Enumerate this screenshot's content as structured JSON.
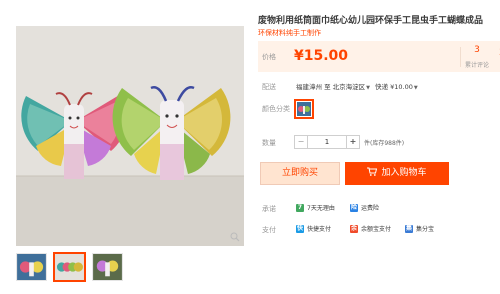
{
  "product": {
    "title": "废物利用纸筒面巾纸心幼儿园环保手工昆虫手工蝴蝶成品",
    "subtitle": "环保材料纯手工制作"
  },
  "price": {
    "label": "价格",
    "value": "¥15.00",
    "review_count": "3",
    "review_label": "累计评论",
    "peek_text": "3"
  },
  "shipping": {
    "label": "配送",
    "from": "福建漳州",
    "to_word": "至",
    "to": "北京海淀区",
    "method": "快递 ¥10.00"
  },
  "color": {
    "label": "颜色分类"
  },
  "quantity": {
    "label": "数量",
    "minus": "−",
    "value": "1",
    "plus": "+",
    "stock": "件(库存988件)"
  },
  "actions": {
    "buy_now": "立即购买",
    "add_cart": "加入购物车"
  },
  "promise": {
    "label": "承诺",
    "items": [
      {
        "icon": "7",
        "text": "7天无理由"
      },
      {
        "icon": "险",
        "text": "运费险"
      }
    ]
  },
  "payment": {
    "label": "支付",
    "items": [
      {
        "icon": "快",
        "text": "快捷支付"
      },
      {
        "icon": "余",
        "text": "余额宝支付"
      },
      {
        "icon": "集",
        "text": "集分宝"
      }
    ]
  },
  "colors": {
    "accent": "#ff4400",
    "price_bg": "#fff2e8",
    "buy_now_bg": "#ffe4d0"
  }
}
